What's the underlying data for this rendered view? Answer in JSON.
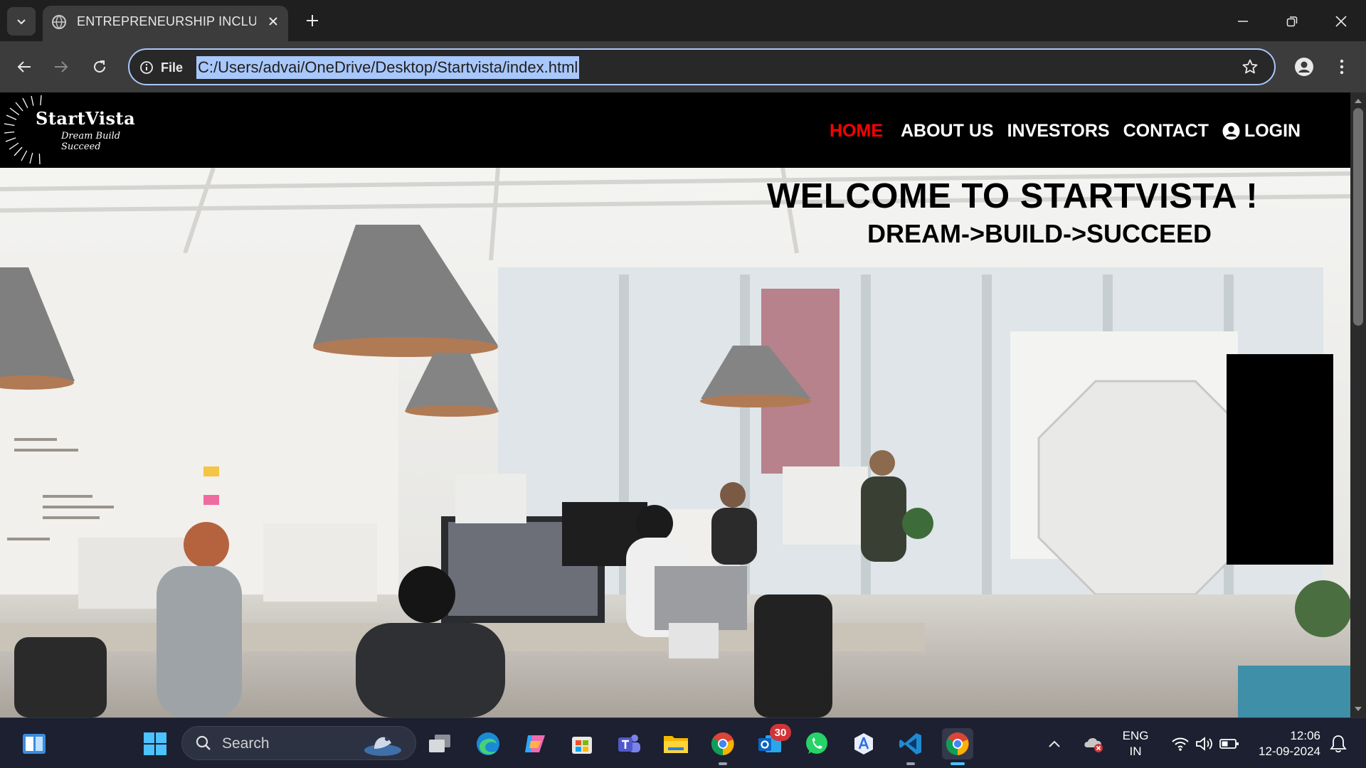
{
  "browser": {
    "tab_title": "ENTREPRENEURSHIP INCLUBLA",
    "address_label": "File",
    "url": "C:/Users/advai/OneDrive/Desktop/Startvista/index.html"
  },
  "site": {
    "logo_name": "StartVista",
    "logo_tagline": "Dream Build Succeed",
    "nav": {
      "home": "HOME",
      "about": "ABOUT US",
      "investors": "INVESTORS",
      "contact": "CONTACT",
      "login": "LOGIN"
    },
    "hero_title": "WELCOME TO STARTVISTA !",
    "hero_tagline": "DREAM->BUILD->SUCCEED",
    "active_color": "#ff0000"
  },
  "taskbar": {
    "search_placeholder": "Search",
    "outlook_badge": "30",
    "lang_line1": "ENG",
    "lang_line2": "IN",
    "time": "12:06",
    "date": "12-09-2024"
  }
}
